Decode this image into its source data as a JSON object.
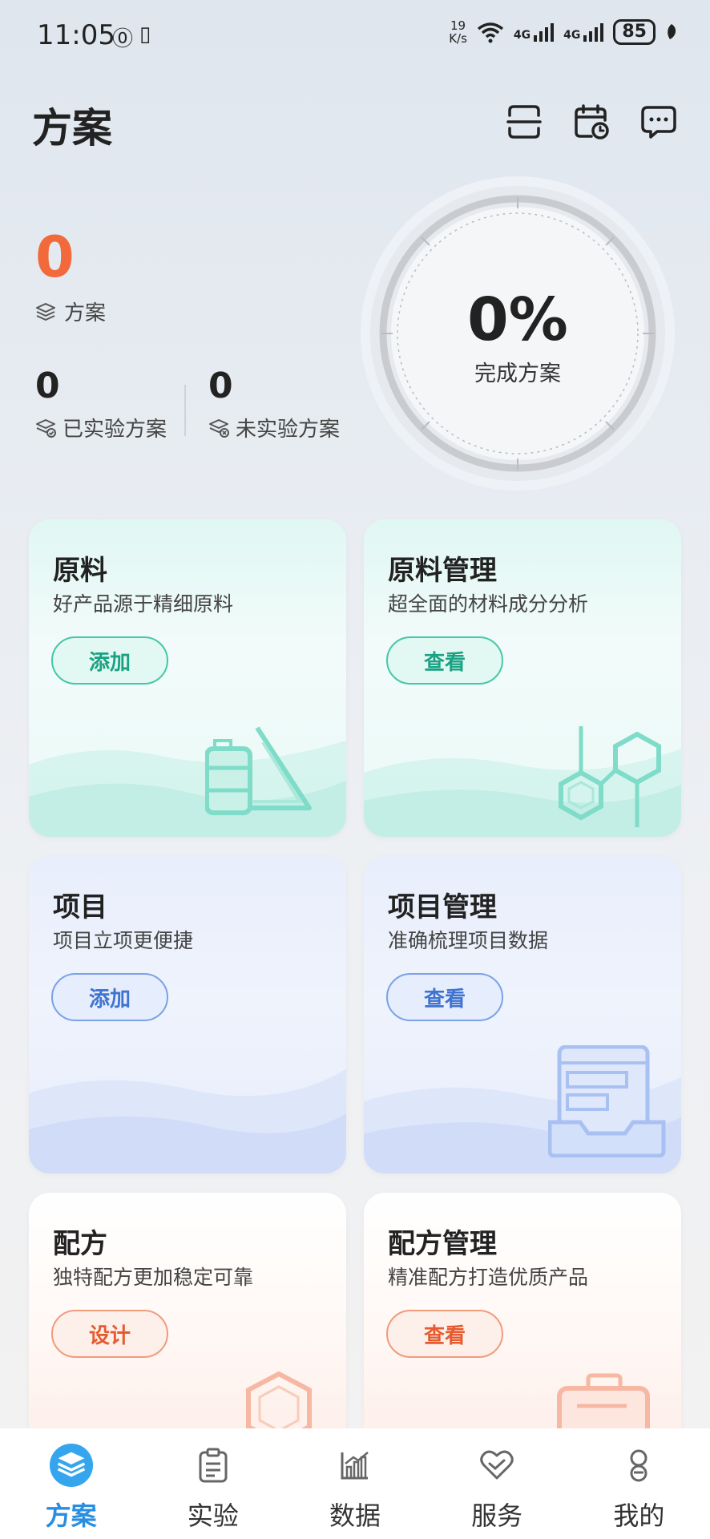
{
  "status_bar": {
    "time": "11:05",
    "net_speed_value": "19",
    "net_speed_unit": "K/s",
    "signal1": "4G",
    "signal2": "4G",
    "battery": "85"
  },
  "header": {
    "title": "方案"
  },
  "stats": {
    "total_value": "0",
    "total_label": "方案",
    "tested_value": "0",
    "tested_label": "已实验方案",
    "untested_value": "0",
    "untested_label": "未实验方案"
  },
  "gauge": {
    "value": "0%",
    "label": "完成方案",
    "completion_fraction": 0
  },
  "cards": [
    {
      "title": "原料",
      "subtitle": "好产品源于精细原料",
      "button": "添加"
    },
    {
      "title": "原料管理",
      "subtitle": "超全面的材料成分分析",
      "button": "查看"
    },
    {
      "title": "项目",
      "subtitle": "项目立项更便捷",
      "button": "添加"
    },
    {
      "title": "项目管理",
      "subtitle": "准确梳理项目数据",
      "button": "查看"
    },
    {
      "title": "配方",
      "subtitle": "独特配方更加稳定可靠",
      "button": "设计"
    },
    {
      "title": "配方管理",
      "subtitle": "精准配方打造优质产品",
      "button": "查看"
    }
  ],
  "tabbar": {
    "items": [
      {
        "label": "方案",
        "icon": "layers-icon",
        "active": true
      },
      {
        "label": "实验",
        "icon": "clipboard-icon",
        "active": false
      },
      {
        "label": "数据",
        "icon": "chart-icon",
        "active": false
      },
      {
        "label": "服务",
        "icon": "handshake-heart-icon",
        "active": false
      },
      {
        "label": "我的",
        "icon": "user-icon",
        "active": false
      }
    ]
  },
  "colors": {
    "accent_orange": "#f26a3c",
    "accent_green": "#19a283",
    "accent_blue": "#3f73cf",
    "tab_active": "#2a8ee0"
  }
}
